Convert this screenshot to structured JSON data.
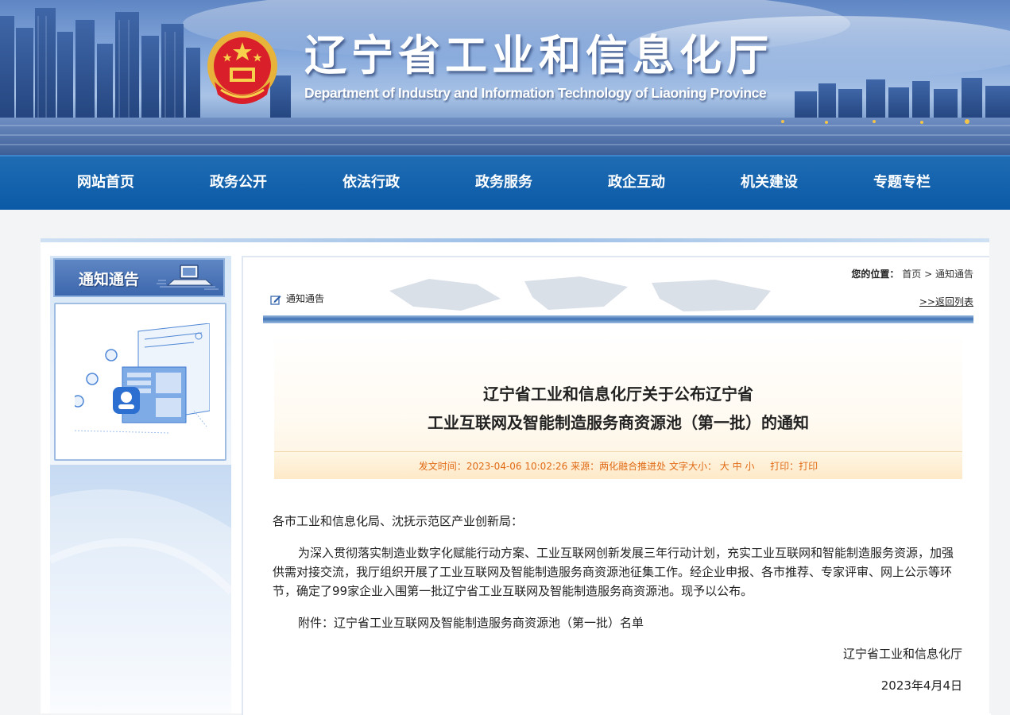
{
  "header": {
    "title": "辽宁省工业和信息化厅",
    "subtitle": "Department of Industry and Information Technology of Liaoning Province",
    "emblem_icon": "national-emblem-icon"
  },
  "nav": {
    "items": [
      "网站首页",
      "政务公开",
      "依法行政",
      "政务服务",
      "政企互动",
      "机关建设",
      "专题专栏"
    ]
  },
  "sidebar": {
    "heading": "通知通告",
    "heading_icon": "laptop-icon",
    "illustration_icon": "web-document-illustration"
  },
  "breadcrumb": {
    "label": "您的位置：",
    "home": "首页",
    "separator": ">",
    "current": "通知通告"
  },
  "section": {
    "title": "通知通告",
    "icon": "edit-icon",
    "back_link": ">>返回列表"
  },
  "article": {
    "title_line1": "辽宁省工业和信息化厅关于公布辽宁省",
    "title_line2": "工业互联网及智能制造服务商资源池（第一批）的通知",
    "meta": {
      "time_label": "发文时间：",
      "time_value": "2023-04-06 10:02:26",
      "source_label": "来源：",
      "source_value": "两化融合推进处",
      "font_label": "文字大小：",
      "font_large": "大",
      "font_medium": "中",
      "font_small": "小",
      "print_label": "打印：",
      "print_value": "打印"
    },
    "salutation": "各市工业和信息化局、沈抚示范区产业创新局：",
    "paragraph1": "为深入贯彻落实制造业数字化赋能行动方案、工业互联网创新发展三年行动计划，充实工业互联网和智能制造服务资源，加强供需对接交流，我厅组织开展了工业互联网及智能制造服务商资源池征集工作。经企业申报、各市推荐、专家评审、网上公示等环节，确定了99家企业入围第一批辽宁省工业互联网及智能制造服务商资源池。现予以公布。",
    "attachment": "附件：辽宁省工业互联网及智能制造服务商资源池（第一批）名单",
    "signature": "辽宁省工业和信息化厅",
    "date": "2023年4月4日"
  },
  "colors": {
    "nav_blue": "#0b5aa7",
    "meta_orange": "#e06a15",
    "banner_blue": "#5f86c4"
  }
}
